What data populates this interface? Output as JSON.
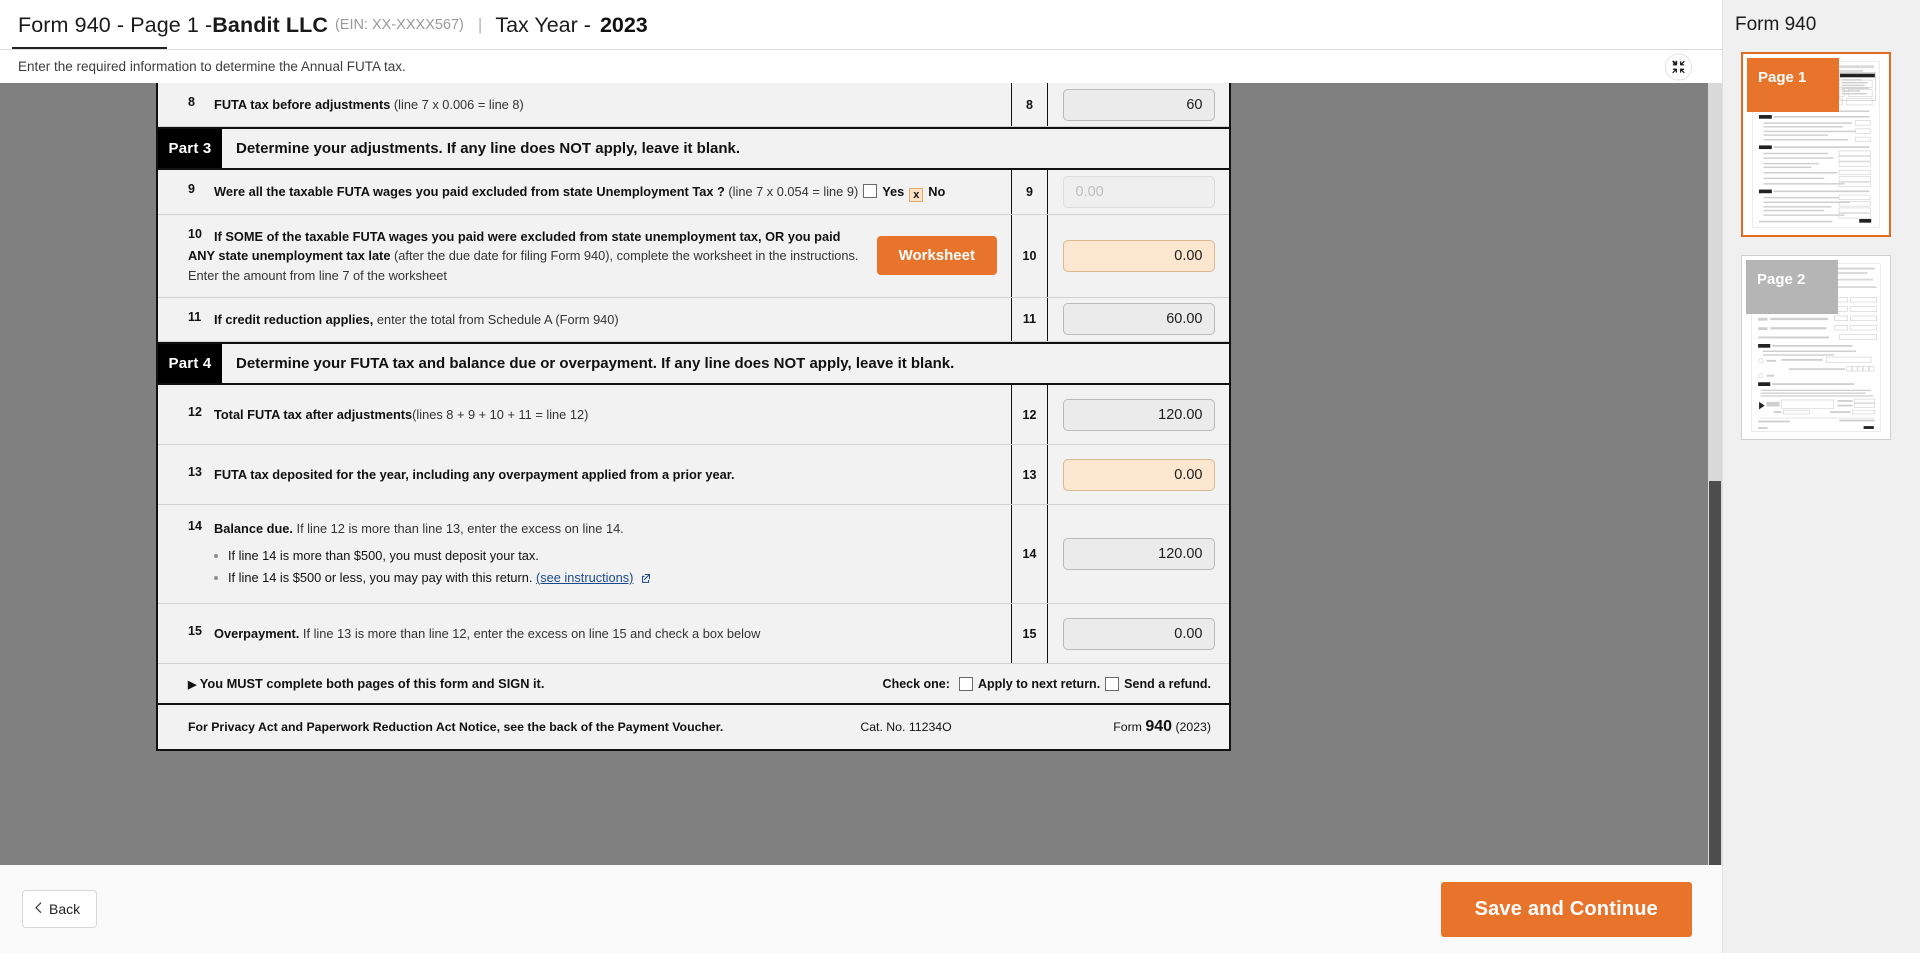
{
  "header": {
    "form_label": "Form 940 - Page 1 - ",
    "company": "Bandit LLC",
    "ein": "(EIN: XX-XXXX567)",
    "separator": "|",
    "tax_year_label": "Tax Year - ",
    "tax_year": "2023",
    "subtitle": "Enter the required information to determine the Annual FUTA tax.",
    "collapse_icon": "collapse-icon"
  },
  "form": {
    "line8": {
      "num": "8",
      "label": "FUTA tax before adjustments",
      "paren": "(line 7 x 0.006 = line 8)",
      "box_num": "8",
      "value": "60"
    },
    "part3": {
      "tag": "Part 3",
      "title": "Determine your adjustments. If any line does NOT apply, leave it blank."
    },
    "line9": {
      "num": "9",
      "label": "Were all the taxable FUTA wages you paid excluded from state Unemployment Tax ?",
      "paren": "(line 7 x 0.054 = line 9)",
      "yes_label": "Yes",
      "no_label": "No",
      "yes_checked": false,
      "no_checked": true,
      "no_mark": "x",
      "box_num": "9",
      "value": "0.00",
      "disabled": true
    },
    "line10": {
      "num": "10",
      "bold1": "If SOME of the taxable FUTA wages you paid were excluded from state unemployment tax, OR you paid ANY state unemployment tax late",
      "rest": " (after the due date for filing Form 940), complete the worksheet in the instructions. Enter the amount from line 7 of the worksheet",
      "worksheet_button": "Worksheet",
      "box_num": "10",
      "value": "0.00",
      "editable": true
    },
    "line11": {
      "num": "11",
      "bold1": "If credit reduction applies,",
      "rest": " enter the total from Schedule A (Form 940)",
      "box_num": "11",
      "value": "60.00"
    },
    "part4": {
      "tag": "Part 4",
      "title": "Determine your FUTA tax and balance due or overpayment. If any line does NOT apply, leave it blank."
    },
    "line12": {
      "num": "12",
      "label": "Total FUTA tax after adjustments",
      "paren": "(lines 8 + 9 + 10 + 11 = line 12)",
      "box_num": "12",
      "value": "120.00"
    },
    "line13": {
      "num": "13",
      "label": "FUTA tax deposited for the year, including any overpayment applied from a prior year.",
      "box_num": "13",
      "value": "0.00",
      "editable": true
    },
    "line14": {
      "num": "14",
      "bold1": "Balance due.",
      "rest": " If line 12 is more than line 13, enter the excess on line 14.",
      "bullet1": "If line 14 is more than $500, you must deposit your tax.",
      "bullet2_pre": "If line 14 is $500 or less, you may pay with this return. ",
      "bullet2_link": "(see instructions)",
      "link_icon": "external-link-icon",
      "box_num": "14",
      "value": "120.00"
    },
    "line15": {
      "num": "15",
      "bold1": "Overpayment.",
      "rest": " If line 13 is more than line 12, enter the excess on line 15 and check a box below",
      "box_num": "15",
      "value": "0.00"
    },
    "sign_row": {
      "arrow": "▶",
      "text": "You MUST complete both pages of this form and  SIGN it.",
      "check_one_label": "Check one:",
      "apply_label": "Apply to next return.",
      "refund_label": "Send a refund.",
      "apply_checked": false,
      "refund_checked": false
    },
    "footer": {
      "privacy": "For Privacy Act and Paperwork Reduction Act Notice, see the back of the Payment Voucher.",
      "cat_no": "Cat. No. 11234O",
      "form_word": "Form ",
      "form_num": "940",
      "form_year": " (2023)"
    }
  },
  "bottom_nav": {
    "back_label": "Back",
    "back_icon": "chevron-left-icon",
    "save_label": "Save and Continue"
  },
  "sidebar": {
    "title": "Form 940",
    "pages": [
      {
        "label": "Page 1",
        "active": true
      },
      {
        "label": "Page 2",
        "active": false
      }
    ]
  },
  "colors": {
    "accent_orange": "#e8742c",
    "editable_field": "#fbe6cf",
    "canvas_gray": "#808080",
    "part_band": "#000000"
  }
}
